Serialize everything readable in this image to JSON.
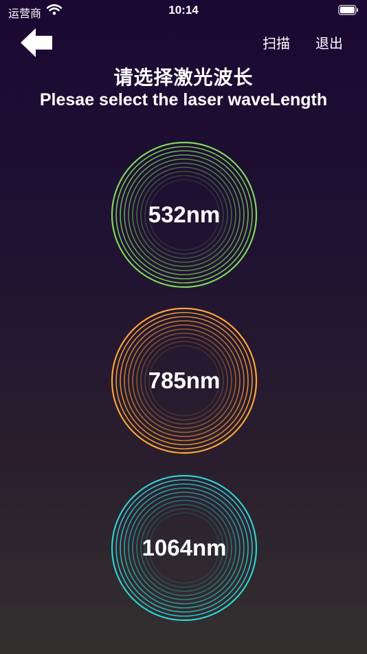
{
  "status_bar": {
    "carrier": "运营商",
    "time": "10:14"
  },
  "nav": {
    "back_icon": "back-arrow-icon",
    "scan_label": "扫描",
    "exit_label": "退出"
  },
  "header": {
    "title_cn": "请选择激光波长",
    "title_en": "Plesae select the laser waveLength"
  },
  "wavelengths": [
    {
      "label": "532nm",
      "color": "#7ed957"
    },
    {
      "label": "785nm",
      "color": "#ffa535"
    },
    {
      "label": "1064nm",
      "color": "#2ed1d4"
    }
  ]
}
